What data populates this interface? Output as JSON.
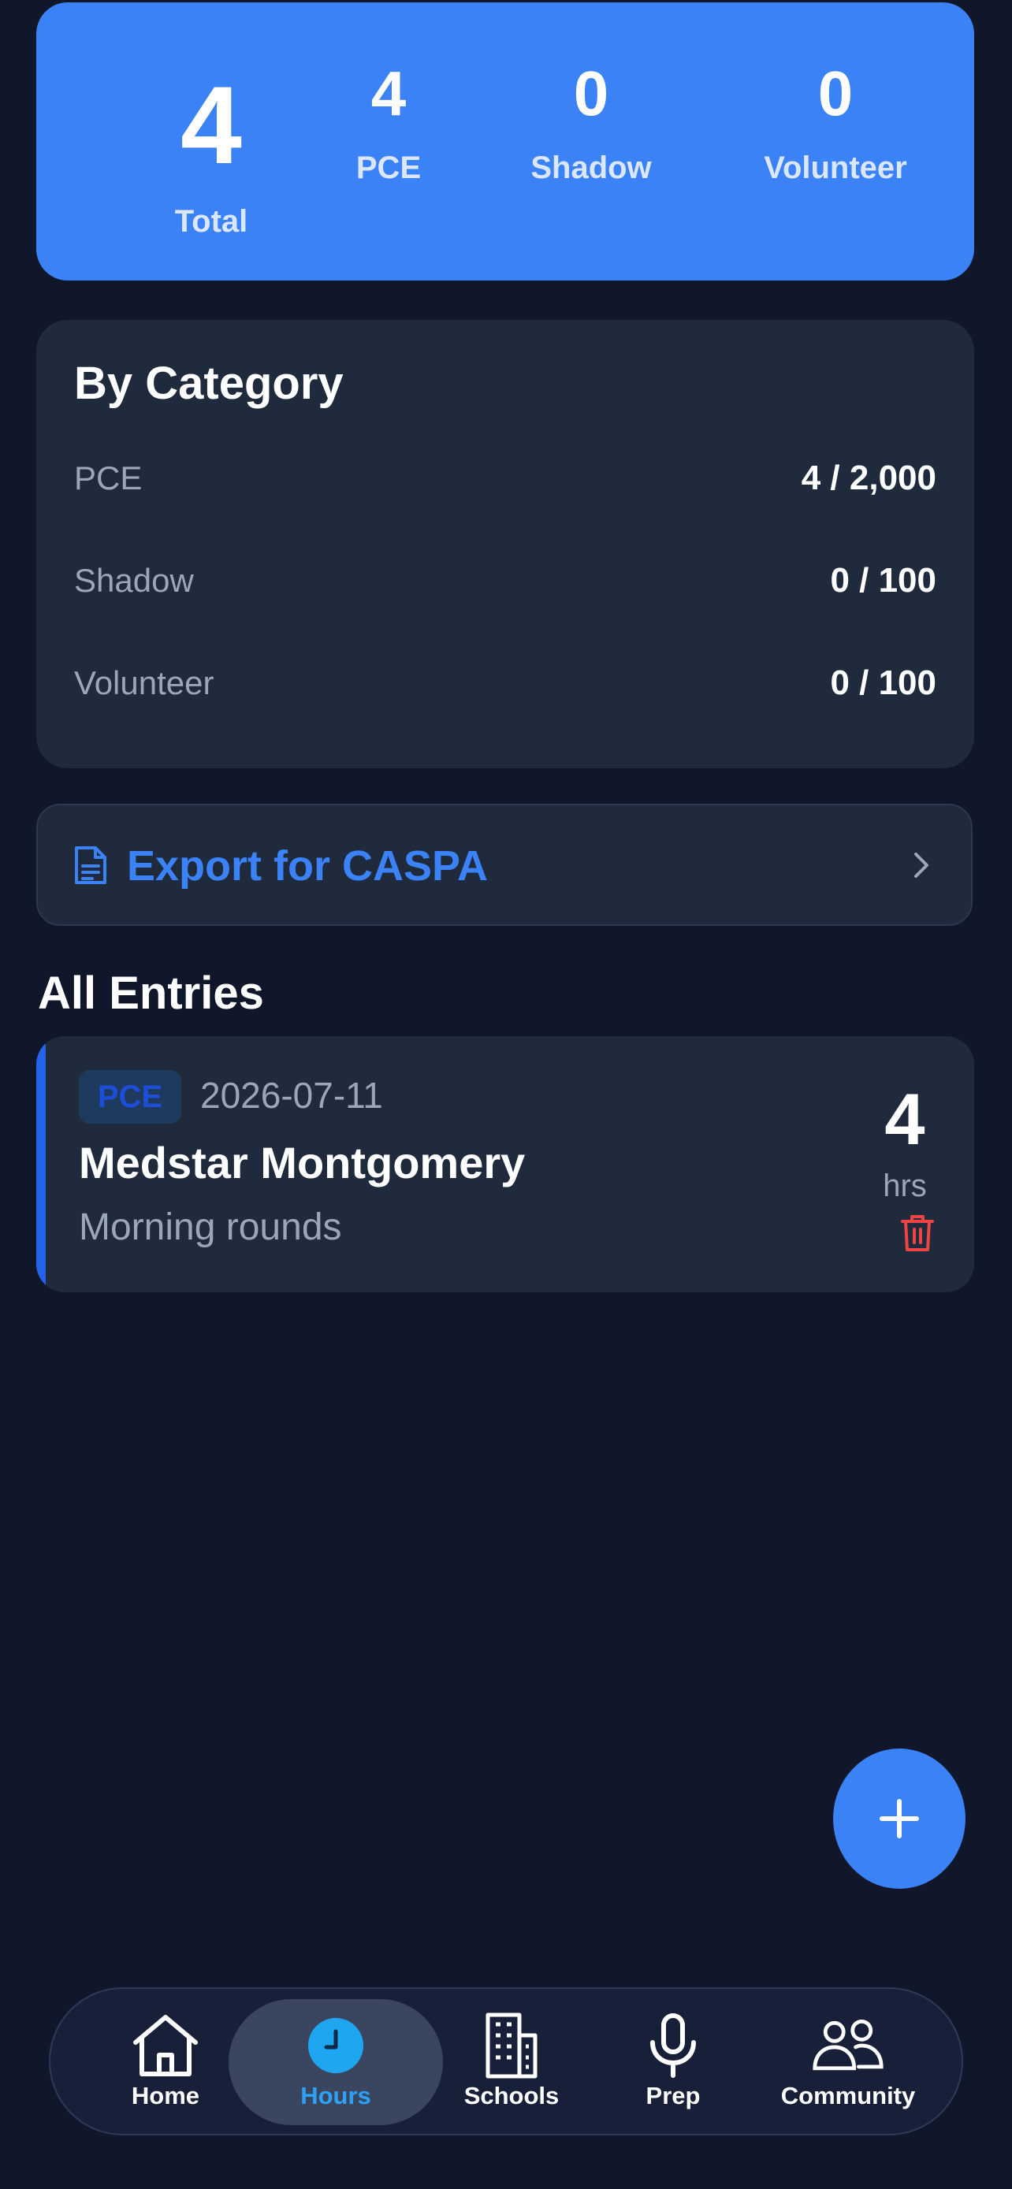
{
  "summary": {
    "total": {
      "value": "4",
      "label": "Total"
    },
    "pce": {
      "value": "4",
      "label": "PCE"
    },
    "shadow": {
      "value": "0",
      "label": "Shadow"
    },
    "volunteer": {
      "value": "0",
      "label": "Volunteer"
    }
  },
  "by_category": {
    "title": "By Category",
    "rows": [
      {
        "name": "PCE",
        "value": "4 / 2,000"
      },
      {
        "name": "Shadow",
        "value": "0 / 100"
      },
      {
        "name": "Volunteer",
        "value": "0 / 100"
      }
    ]
  },
  "export": {
    "label": "Export for CASPA",
    "icon": "document-icon"
  },
  "entries": {
    "title": "All Entries",
    "items": [
      {
        "category": "PCE",
        "date": "2026-07-11",
        "title": "Medstar Montgomery",
        "description": "Morning rounds",
        "hours": "4",
        "hours_unit": "hrs"
      }
    ]
  },
  "fab": {
    "icon": "plus-icon"
  },
  "nav": {
    "items": [
      {
        "label": "Home",
        "icon": "home-icon"
      },
      {
        "label": "Hours",
        "icon": "clock-icon",
        "active": true
      },
      {
        "label": "Schools",
        "icon": "building-icon"
      },
      {
        "label": "Prep",
        "icon": "microphone-icon"
      },
      {
        "label": "Community",
        "icon": "people-icon"
      }
    ]
  },
  "colors": {
    "background": "#10172b",
    "accent": "#3b82f6",
    "card": "#1f2a3d",
    "muted_text": "#9aa6ba",
    "danger": "#ef4444",
    "nav_active": "#2da1f5"
  }
}
